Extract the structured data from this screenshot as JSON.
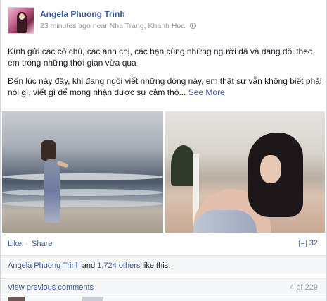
{
  "post": {
    "author": "Angela Phuong Trinh",
    "time": "23 minutes ago",
    "location_prefix": "near",
    "location": "Nha Trang, Khanh Hoa",
    "paragraphs": [
      "Kính gửi các cô chú, các anh chị, các bạn cùng những người đã và đang dõi theo em trong những thời gian vừa qua",
      "Đến lúc này đây, khi đang ngồi viết những dòng này, em thật sự vẫn không biết phải nói gì, viết gì để mong nhận được sự cảm thô..."
    ],
    "see_more": "See More"
  },
  "actions": {
    "like": "Like",
    "separator": "·",
    "share": "Share",
    "comment_count": "32"
  },
  "likes": {
    "first_name": "Angela Phuong Trinh",
    "and": "and",
    "others": "1,724 others",
    "suffix": "like this."
  },
  "comments": {
    "view_previous": "View previous comments",
    "count": "4 of 229"
  },
  "icons": {
    "privacy": "globe-icon",
    "comment": "comment-icon"
  }
}
